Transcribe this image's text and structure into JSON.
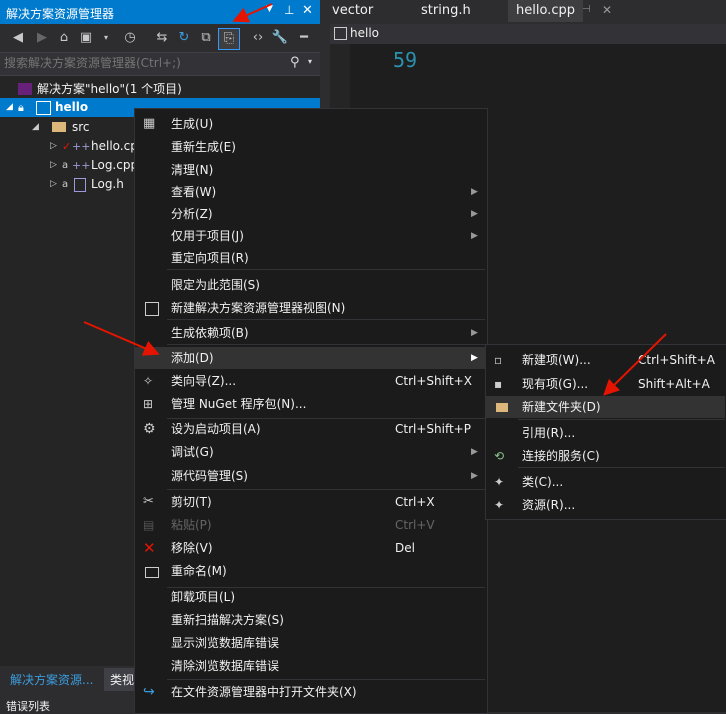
{
  "solution_explorer": {
    "title": "解决方案资源管理器",
    "search_placeholder": "搜索解决方案资源管理器(Ctrl+;)",
    "tree": {
      "solution": "解决方案\"hello\"(1 个项目)",
      "project": "hello",
      "folder": "src",
      "files": [
        "hello.cpp",
        "Log.cpp",
        "Log.h"
      ]
    },
    "bottom_tabs": [
      "解决方案资源...",
      "类视"
    ]
  },
  "editor": {
    "tabs": [
      "vector",
      "string.h",
      "hello.cpp"
    ],
    "nav_scope": "hello",
    "line_number": "59"
  },
  "error_list_label": "错误列表",
  "context_menu": {
    "items": [
      {
        "label": "生成(U)",
        "icon": "build-icon"
      },
      {
        "label": "重新生成(E)"
      },
      {
        "label": "清理(N)"
      },
      {
        "label": "查看(W)",
        "submenu": true
      },
      {
        "label": "分析(Z)",
        "submenu": true
      },
      {
        "label": "仅用于项目(J)",
        "submenu": true
      },
      {
        "label": "重定向项目(R)"
      },
      {
        "label": "限定为此范围(S)"
      },
      {
        "label": "新建解决方案资源管理器视图(N)",
        "icon": "new-view-icon"
      },
      {
        "label": "生成依赖项(B)",
        "submenu": true
      },
      {
        "label": "添加(D)",
        "submenu": true
      },
      {
        "label": "类向导(Z)...",
        "shortcut": "Ctrl+Shift+X",
        "icon": "class-wizard-icon"
      },
      {
        "label": "管理 NuGet 程序包(N)...",
        "icon": "nuget-icon"
      },
      {
        "label": "设为启动项目(A)",
        "shortcut": "Ctrl+Shift+P",
        "icon": "gear-icon"
      },
      {
        "label": "调试(G)",
        "submenu": true
      },
      {
        "label": "源代码管理(S)",
        "submenu": true
      },
      {
        "label": "剪切(T)",
        "shortcut": "Ctrl+X",
        "icon": "cut-icon"
      },
      {
        "label": "粘贴(P)",
        "shortcut": "Ctrl+V",
        "icon": "paste-icon",
        "disabled": true
      },
      {
        "label": "移除(V)",
        "shortcut": "Del",
        "icon": "remove-icon"
      },
      {
        "label": "重命名(M)",
        "icon": "rename-icon"
      },
      {
        "label": "卸载项目(L)"
      },
      {
        "label": "重新扫描解决方案(S)"
      },
      {
        "label": "显示浏览数据库错误"
      },
      {
        "label": "清除浏览数据库错误"
      },
      {
        "label": "在文件资源管理器中打开文件夹(X)",
        "icon": "refresh-arrow-icon"
      }
    ]
  },
  "add_submenu": {
    "items": [
      {
        "label": "新建项(W)...",
        "shortcut": "Ctrl+Shift+A",
        "icon": "new-item-icon"
      },
      {
        "label": "现有项(G)...",
        "shortcut": "Shift+Alt+A",
        "icon": "existing-item-icon"
      },
      {
        "label": "新建文件夹(D)",
        "icon": "new-folder-icon"
      },
      {
        "label": "引用(R)..."
      },
      {
        "label": "连接的服务(C)",
        "icon": "connected-service-icon"
      },
      {
        "label": "类(C)...",
        "icon": "class-icon"
      },
      {
        "label": "资源(R)...",
        "icon": "resource-icon"
      }
    ]
  },
  "colors": {
    "accent": "#007acc",
    "arrow": "#e51400",
    "line_number": "#2b91af"
  }
}
